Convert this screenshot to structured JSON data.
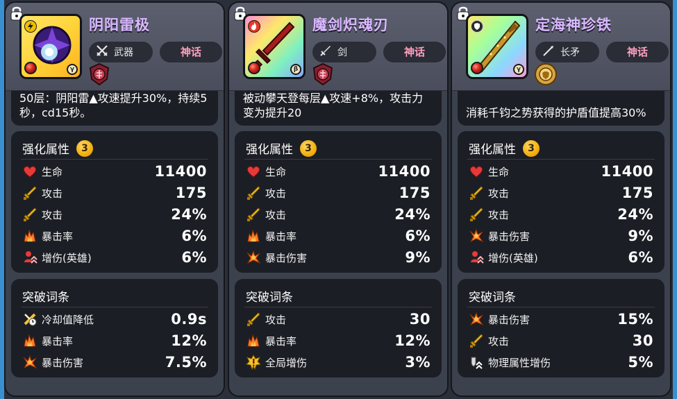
{
  "colors": {
    "background": "#2a2f3a",
    "card": "#3c414e",
    "panel": "#1c1e25",
    "name_text": "#d9b8ff",
    "rarity_text": "#ff9fbf",
    "level_badge": "#f0a800",
    "heart": "#e63a3a",
    "sword": "#f5c32a",
    "crit": "#ff7b25"
  },
  "cards": [
    {
      "name": "阴阳雷极",
      "type_label": "武器",
      "type_icon": "crossed-swords-icon",
      "rarity": "神话",
      "element_icon": "lightning-icon",
      "rank": "γ",
      "emblem_icon": "red-crest-emblem-icon",
      "description": "50层：阴阳雷▲攻速提升30%，持续5秒，cd15秒。",
      "enhance": {
        "title": "强化属性",
        "level": "3",
        "stats": [
          {
            "icon": "heart-icon",
            "label": "生命",
            "value": "11400"
          },
          {
            "icon": "sword-icon",
            "label": "攻击",
            "value": "175"
          },
          {
            "icon": "sword-icon",
            "label": "攻击",
            "value": "24%"
          },
          {
            "icon": "crit-rate-icon",
            "label": "暴击率",
            "value": "6%"
          },
          {
            "icon": "hero-damage-icon",
            "label": "增伤(英雄)",
            "value": "6%"
          }
        ]
      },
      "breakthrough": {
        "title": "突破词条",
        "stats": [
          {
            "icon": "cooldown-icon",
            "label": "冷却值降低",
            "value": "0.9s"
          },
          {
            "icon": "crit-rate-icon",
            "label": "暴击率",
            "value": "12%"
          },
          {
            "icon": "crit-damage-icon",
            "label": "暴击伤害",
            "value": "7.5%"
          }
        ]
      }
    },
    {
      "name": "魔剑炽魂刃",
      "type_label": "剑",
      "type_icon": "sword-type-icon",
      "rarity": "神话",
      "element_icon": "fire-icon",
      "rank": "β",
      "emblem_icon": "red-crest-emblem-icon",
      "description": "被动攀天登每层▲攻速+8%，攻击力变为提升20",
      "enhance": {
        "title": "强化属性",
        "level": "3",
        "stats": [
          {
            "icon": "heart-icon",
            "label": "生命",
            "value": "11400"
          },
          {
            "icon": "sword-icon",
            "label": "攻击",
            "value": "175"
          },
          {
            "icon": "sword-icon",
            "label": "攻击",
            "value": "24%"
          },
          {
            "icon": "crit-rate-icon",
            "label": "暴击率",
            "value": "6%"
          },
          {
            "icon": "crit-damage-icon",
            "label": "暴击伤害",
            "value": "9%"
          }
        ]
      },
      "breakthrough": {
        "title": "突破词条",
        "stats": [
          {
            "icon": "sword-icon",
            "label": "攻击",
            "value": "30"
          },
          {
            "icon": "crit-rate-icon",
            "label": "暴击率",
            "value": "12%"
          },
          {
            "icon": "global-damage-icon",
            "label": "全局增伤",
            "value": "3%"
          }
        ]
      }
    },
    {
      "name": "定海神珍铁",
      "type_label": "长矛",
      "type_icon": "spear-type-icon",
      "rarity": "神话",
      "element_icon": "shield-icon",
      "rank": "γ",
      "emblem_icon": "gold-lion-emblem-icon",
      "description": "消耗千钧之势获得的护盾值提高30%",
      "enhance": {
        "title": "强化属性",
        "level": "3",
        "stats": [
          {
            "icon": "heart-icon",
            "label": "生命",
            "value": "11400"
          },
          {
            "icon": "sword-icon",
            "label": "攻击",
            "value": "175"
          },
          {
            "icon": "sword-icon",
            "label": "攻击",
            "value": "24%"
          },
          {
            "icon": "crit-damage-icon",
            "label": "暴击伤害",
            "value": "9%"
          },
          {
            "icon": "hero-damage-icon",
            "label": "增伤(英雄)",
            "value": "6%"
          }
        ]
      },
      "breakthrough": {
        "title": "突破词条",
        "stats": [
          {
            "icon": "crit-damage-icon",
            "label": "暴击伤害",
            "value": "15%"
          },
          {
            "icon": "sword-icon",
            "label": "攻击",
            "value": "30"
          },
          {
            "icon": "physical-damage-icon",
            "label": "物理属性增伤",
            "value": "5%"
          }
        ]
      }
    }
  ]
}
